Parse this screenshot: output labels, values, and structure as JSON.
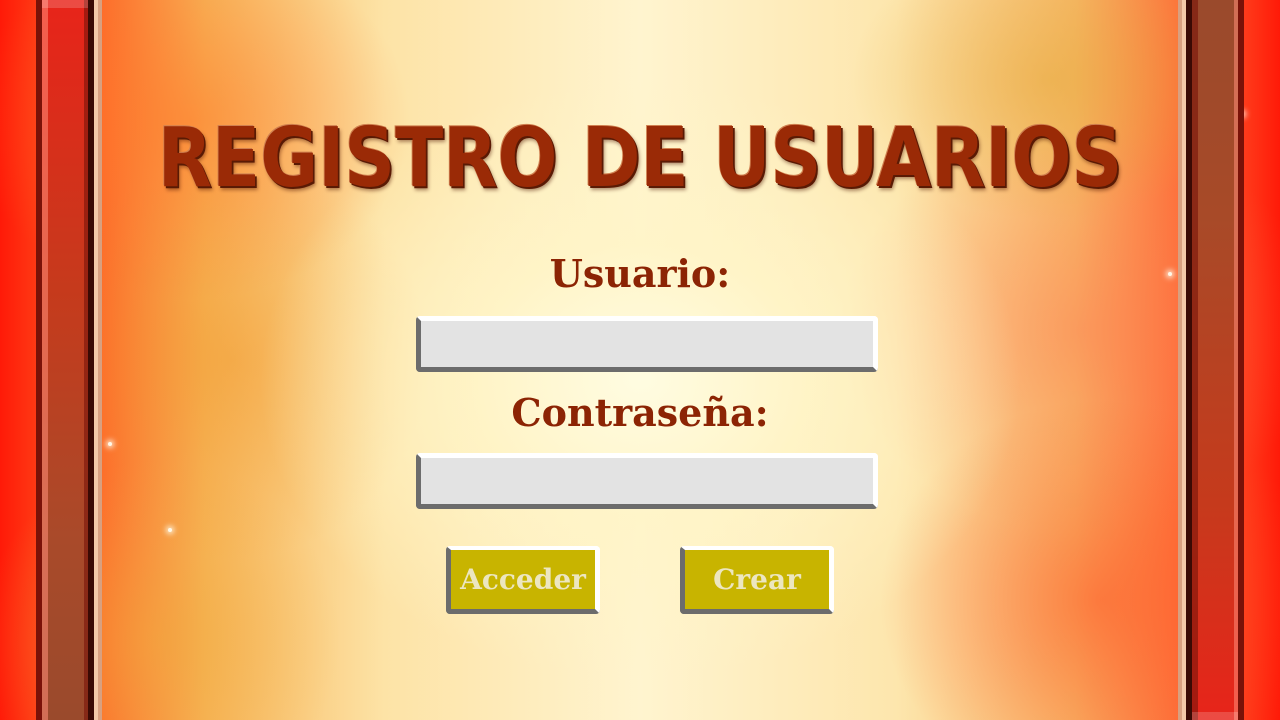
{
  "title": "REGISTRO DE USUARIOS",
  "form": {
    "username_label": "Usuario:",
    "username_value": "",
    "password_label": "Contraseña:",
    "password_value": ""
  },
  "buttons": {
    "login_label": "Acceder",
    "create_label": "Crear"
  },
  "colors": {
    "title": "#9a2a06",
    "labels": "#8c2404",
    "button_bg": "#c8b400",
    "button_text": "#ece6c0",
    "input_bg": "#e3e3e3",
    "pillar": "#c63a1c"
  }
}
